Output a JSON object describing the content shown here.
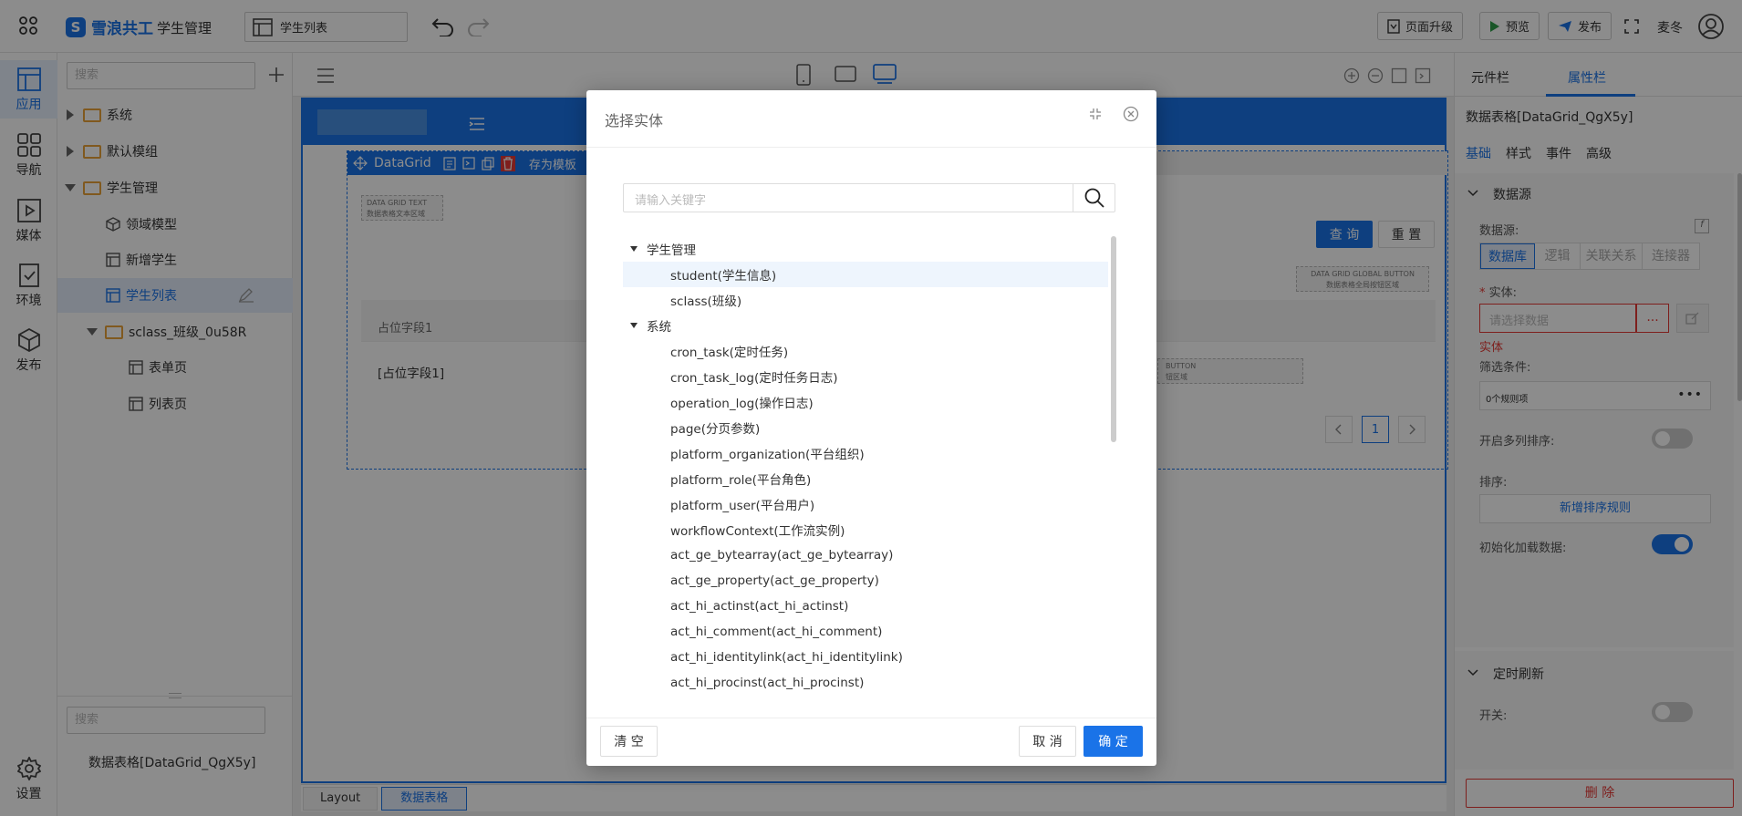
{
  "topbar": {
    "brand": "雪浪共工",
    "app_name": "学生管理",
    "page_select": "学生列表",
    "btn_upgrade": "页面升级",
    "btn_preview": "预览",
    "btn_publish": "发布",
    "user": "麦冬"
  },
  "rail": {
    "items": [
      {
        "label": "应用"
      },
      {
        "label": "导航"
      },
      {
        "label": "媒体"
      },
      {
        "label": "环境"
      },
      {
        "label": "发布"
      }
    ],
    "settings": "设置"
  },
  "tree": {
    "search_placeholder": "搜索",
    "items": [
      {
        "label": "系统"
      },
      {
        "label": "默认模组"
      },
      {
        "label": "学生管理"
      },
      {
        "label": "领域模型"
      },
      {
        "label": "新增学生"
      },
      {
        "label": "学生列表"
      },
      {
        "label": "sclass_班级_0u58R"
      },
      {
        "label": "表单页"
      },
      {
        "label": "列表页"
      }
    ],
    "search2_placeholder": "搜索",
    "selected_component": "数据表格[DataGrid_QgX5y]"
  },
  "canvas": {
    "datagrid_label": "DataGrid",
    "save_template": "存为模板",
    "text_area_en": "DATA GRID TEXT",
    "text_area_cn": "数据表格文本区域",
    "btn_query": "查 询",
    "btn_reset": "重 置",
    "global_btn_en": "DATA GRID GLOBAL BUTTON",
    "global_btn_cn": "数据表格全局按钮区域",
    "col_header": "占位字段1",
    "cell_value": "[占位字段1]",
    "row_btn_en": "BUTTON",
    "row_btn_cn": "钮区域",
    "page_num": "1",
    "crumbs": [
      "Layout",
      "数据表格"
    ]
  },
  "right_panel": {
    "tabs": [
      "元件栏",
      "属性栏"
    ],
    "component_title": "数据表格[DataGrid_QgX5y]",
    "subtabs": [
      "基础",
      "样式",
      "事件",
      "高级"
    ],
    "section_datasource": "数据源",
    "datasource_label": "数据源:",
    "datasource_options": [
      "数据库",
      "逻辑",
      "关联关系",
      "连接器"
    ],
    "entity_label": "实体:",
    "entity_placeholder": "请选择数据",
    "entity_error": "实体",
    "filter_label": "筛选条件:",
    "filter_value": "0个规则项",
    "multi_sort_label": "开启多列排序:",
    "sort_label": "排序:",
    "add_sort": "新增排序规则",
    "init_load_label": "初始化加载数据:",
    "section_timer": "定时刷新",
    "switch_label": "开关:",
    "delete": "删 除"
  },
  "modal": {
    "title": "选择实体",
    "search_placeholder": "请输入关键字",
    "groups": [
      {
        "label": "学生管理",
        "children": [
          "student(学生信息)",
          "sclass(班级)"
        ]
      },
      {
        "label": "系统",
        "children": [
          "cron_task(定时任务)",
          "cron_task_log(定时任务日志)",
          "operation_log(操作日志)",
          "page(分页参数)",
          "platform_organization(平台组织)",
          "platform_role(平台角色)",
          "platform_user(平台用户)",
          "workflowContext(工作流实例)",
          "act_ge_bytearray(act_ge_bytearray)",
          "act_ge_property(act_ge_property)",
          "act_hi_actinst(act_hi_actinst)",
          "act_hi_comment(act_hi_comment)",
          "act_hi_identitylink(act_hi_identitylink)",
          "act_hi_procinst(act_hi_procinst)"
        ]
      }
    ],
    "btn_clear": "清 空",
    "btn_cancel": "取 消",
    "btn_ok": "确 定"
  },
  "colors": {
    "accent": "#1a73e8",
    "danger": "#e53935",
    "folder": "#e9a33a"
  }
}
